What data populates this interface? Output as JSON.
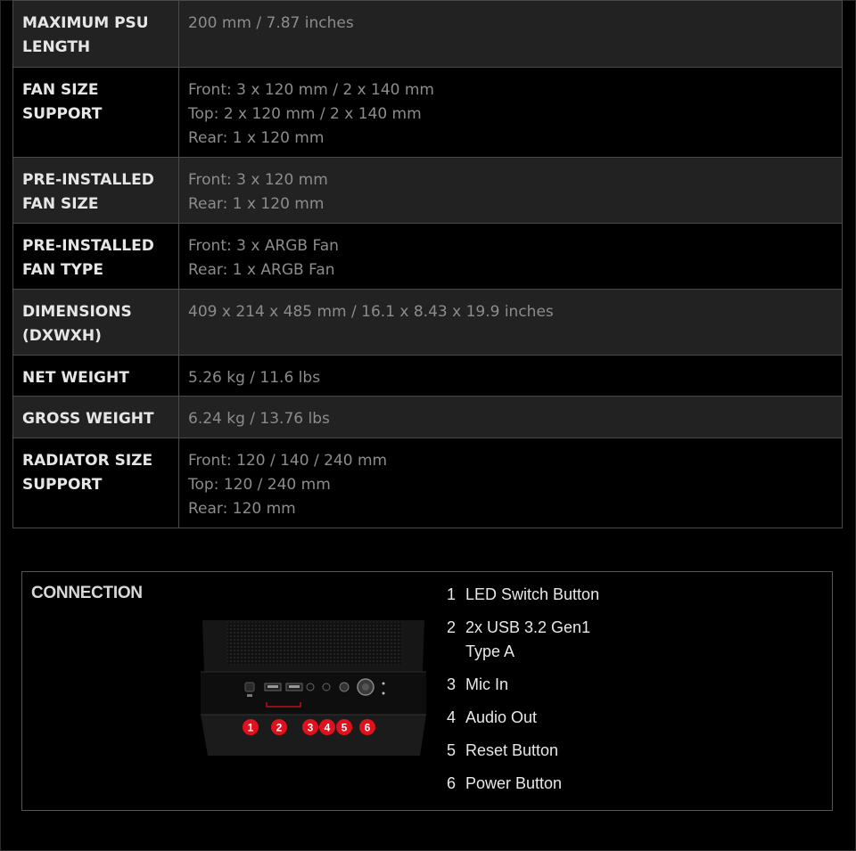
{
  "specs": [
    {
      "label": [
        "MAXIMUM PSU",
        "LENGTH"
      ],
      "value": [
        "200 mm / 7.87 inches"
      ]
    },
    {
      "label": [
        "FAN SIZE",
        "SUPPORT"
      ],
      "value": [
        "Front: 3 x 120 mm / 2 x 140 mm",
        "Top: 2 x 120 mm / 2 x 140 mm",
        "Rear: 1 x 120 mm"
      ]
    },
    {
      "label": [
        "PRE-INSTALLED",
        "FAN SIZE"
      ],
      "value": [
        "Front: 3 x 120 mm",
        "Rear: 1 x 120 mm"
      ]
    },
    {
      "label": [
        "PRE-INSTALLED",
        "FAN TYPE"
      ],
      "value": [
        "Front: 3 x ARGB Fan",
        "Rear: 1 x ARGB Fan"
      ]
    },
    {
      "label": [
        "DIMENSIONS",
        "(DXWXH)"
      ],
      "value": [
        "409 x 214 x 485 mm / 16.1 x 8.43 x 19.9 inches"
      ]
    },
    {
      "label": [
        "NET WEIGHT"
      ],
      "value": [
        "5.26 kg / 11.6 lbs"
      ]
    },
    {
      "label": [
        "GROSS WEIGHT"
      ],
      "value": [
        "6.24 kg / 13.76 lbs"
      ]
    },
    {
      "label": [
        "RADIATOR SIZE",
        "SUPPORT"
      ],
      "value": [
        "Front: 120 / 140 / 240 mm",
        "Top: 120 / 240 mm",
        "Rear: 120 mm"
      ]
    }
  ],
  "connection": {
    "title": "CONNECTION",
    "markers": [
      "1",
      "2",
      "3",
      "4",
      "5",
      "6"
    ],
    "marker_color": "#e0101c",
    "items": [
      {
        "num": "1",
        "lines": [
          "LED Switch Button"
        ]
      },
      {
        "num": "2",
        "lines": [
          "2x USB 3.2 Gen1",
          "Type A"
        ]
      },
      {
        "num": "3",
        "lines": [
          "Mic In"
        ]
      },
      {
        "num": "4",
        "lines": [
          "Audio Out"
        ]
      },
      {
        "num": "5",
        "lines": [
          "Reset Button"
        ]
      },
      {
        "num": "6",
        "lines": [
          "Power Button"
        ]
      }
    ]
  }
}
